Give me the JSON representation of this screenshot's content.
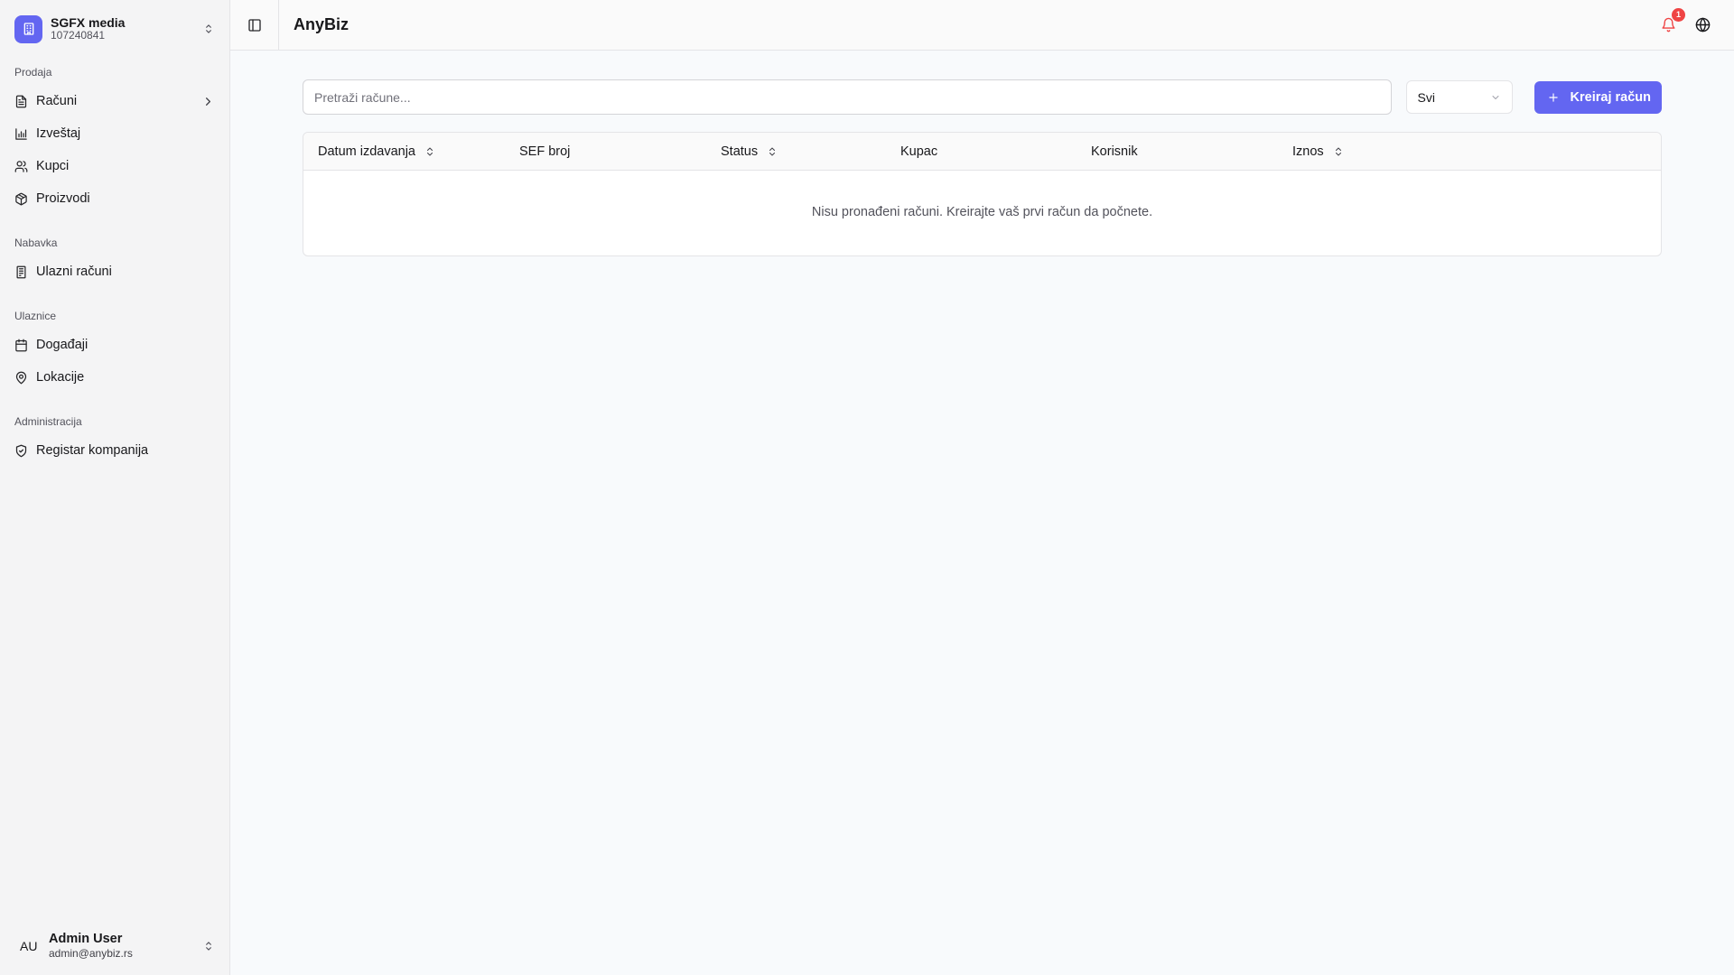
{
  "company": {
    "name": "SGFX media",
    "id": "107240841"
  },
  "nav": {
    "groups": [
      {
        "label": "Prodaja",
        "items": [
          {
            "label": "Računi"
          },
          {
            "label": "Izveštaj"
          },
          {
            "label": "Kupci"
          },
          {
            "label": "Proizvodi"
          }
        ]
      },
      {
        "label": "Nabavka",
        "items": [
          {
            "label": "Ulazni računi"
          }
        ]
      },
      {
        "label": "Ulaznice",
        "items": [
          {
            "label": "Događaji"
          },
          {
            "label": "Lokacije"
          }
        ]
      },
      {
        "label": "Administracija",
        "items": [
          {
            "label": "Registar kompanija"
          }
        ]
      }
    ]
  },
  "user": {
    "initials": "AU",
    "name": "Admin User",
    "email": "admin@anybiz.rs"
  },
  "header": {
    "title": "AnyBiz",
    "notification_count": "1"
  },
  "toolbar": {
    "search_placeholder": "Pretraži račune...",
    "filter_value": "Svi",
    "create_label": "Kreiraj račun"
  },
  "table": {
    "columns": [
      "Datum izdavanja",
      "SEF broj",
      "Status",
      "Kupac",
      "Korisnik",
      "Iznos"
    ],
    "empty_message": "Nisu pronađeni računi. Kreirajte vaš prvi račun da počnete."
  },
  "colors": {
    "accent": "#6366f1",
    "badge": "#ef4444"
  }
}
